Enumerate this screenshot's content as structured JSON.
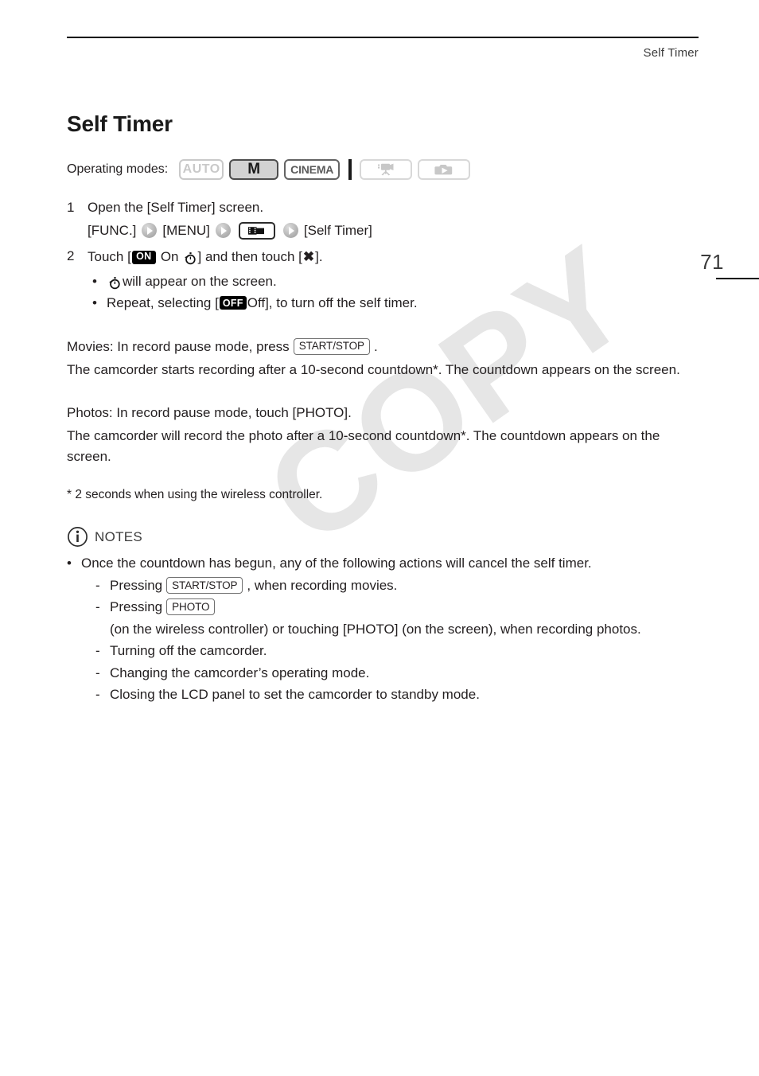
{
  "header": {
    "running_title": "Self Timer",
    "page_number": "71"
  },
  "watermark": {
    "text": "COPY"
  },
  "main": {
    "title": "Self Timer",
    "operating_modes": {
      "label": "Operating modes:",
      "badges": [
        {
          "name": "auto",
          "text": "AUTO",
          "state": "disabled"
        },
        {
          "name": "manual",
          "text": "M",
          "state": "active"
        },
        {
          "name": "cinema",
          "text": "CINEMA",
          "state": "available"
        }
      ],
      "icon_badges": [
        {
          "name": "movie-playback-icon",
          "state": "disabled"
        },
        {
          "name": "photo-playback-icon",
          "state": "disabled"
        }
      ]
    },
    "steps": [
      {
        "number": "1",
        "text": "Open the [Self Timer] screen.",
        "path": {
          "start": "[FUNC.]",
          "menu": "[MENU]",
          "end": "[Self Timer]"
        }
      },
      {
        "number": "2",
        "prefix": "Touch [",
        "on_badge": "ON",
        "on_label": "On",
        "mid": "] and then touch [",
        "suffix": "].",
        "bullets": [
          {
            "pre": "",
            "post": " will appear on the screen."
          },
          {
            "pre": "Repeat, selecting [",
            "badge": "OFF",
            "post": " Off], to turn off the self timer."
          }
        ]
      }
    ],
    "sections": [
      {
        "name": "movies",
        "head_before": "Movies: In record pause mode, press",
        "head_key": "START/STOP",
        "head_after": ".",
        "body": "The camcorder starts recording after a 10-second countdown*. The countdown appears on the screen."
      },
      {
        "name": "photos",
        "head_before": "Photos: In record pause mode, touch [PHOTO].",
        "head_key": "",
        "head_after": "",
        "body": "The camcorder will record the photo after a 10-second countdown*. The countdown appears on the screen."
      }
    ],
    "footnote": "* 2 seconds when using the wireless controller.",
    "notes": {
      "title": "NOTES",
      "items": [
        {
          "text": "Once the countdown has begun, any of the following actions will cancel the self timer.",
          "sub_items": [
            {
              "before": "Pressing",
              "key": "START/STOP",
              "after": ", when recording movies."
            },
            {
              "before": "Pressing",
              "key": "PHOTO",
              "after": "(on the wireless controller) or touching [PHOTO] (on the screen), when recording photos."
            },
            {
              "before": "Turning off the camcorder.",
              "key": "",
              "after": ""
            },
            {
              "before": "Changing the camcorder’s operating mode.",
              "key": "",
              "after": ""
            },
            {
              "before": "Closing the LCD panel to set the camcorder to standby mode.",
              "key": "",
              "after": ""
            }
          ]
        }
      ]
    }
  },
  "colors": {
    "text": "#231f20",
    "muted": "#3b3b3b",
    "disabled": "#c9c9c9",
    "badge_bg": "#000000",
    "watermark": "#e6e6e6"
  }
}
